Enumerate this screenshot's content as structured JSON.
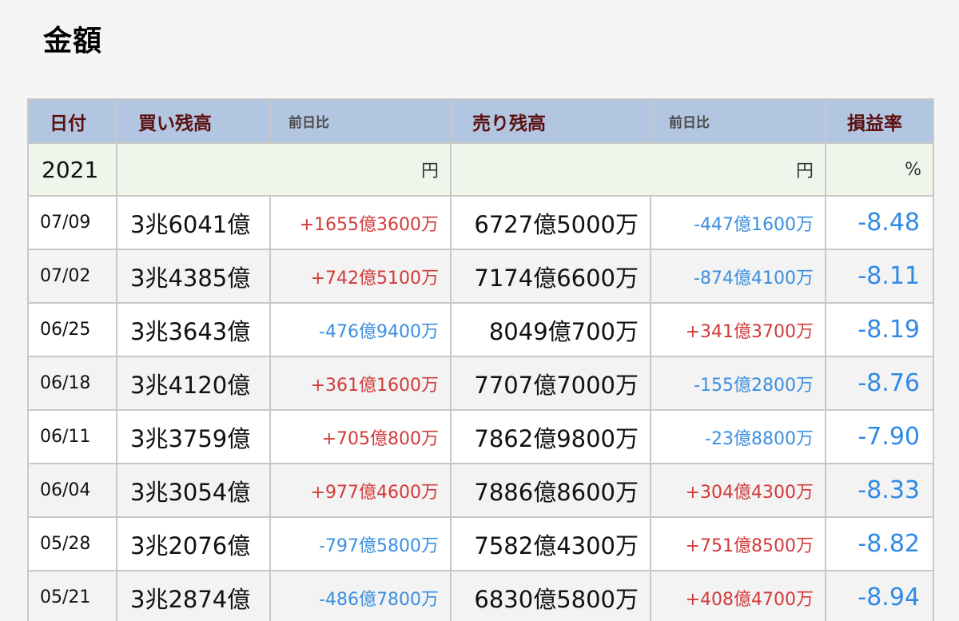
{
  "title": "金額",
  "table": {
    "headers": {
      "date": "日付",
      "buy_balance": "買い残高",
      "buy_change": "前日比",
      "sell_balance": "売り残高",
      "sell_change": "前日比",
      "pl_rate": "損益率"
    },
    "year": "2021",
    "units": {
      "buy": "円",
      "sell": "円",
      "rate": "%"
    },
    "rows": [
      {
        "date": "07/09",
        "buy": "3兆6041億",
        "buy_change": "+1655億3600万",
        "sell": "6727億5000万",
        "sell_change": "-447億1600万",
        "rate": "-8.48"
      },
      {
        "date": "07/02",
        "buy": "3兆4385億",
        "buy_change": "+742億5100万",
        "sell": "7174億6600万",
        "sell_change": "-874億4100万",
        "rate": "-8.11"
      },
      {
        "date": "06/25",
        "buy": "3兆3643億",
        "buy_change": "-476億9400万",
        "sell": "8049億700万",
        "sell_change": "+341億3700万",
        "rate": "-8.19"
      },
      {
        "date": "06/18",
        "buy": "3兆4120億",
        "buy_change": "+361億1600万",
        "sell": "7707億7000万",
        "sell_change": "-155億2800万",
        "rate": "-8.76"
      },
      {
        "date": "06/11",
        "buy": "3兆3759億",
        "buy_change": "+705億800万",
        "sell": "7862億9800万",
        "sell_change": "-23億8800万",
        "rate": "-7.90"
      },
      {
        "date": "06/04",
        "buy": "3兆3054億",
        "buy_change": "+977億4600万",
        "sell": "7886億8600万",
        "sell_change": "+304億4300万",
        "rate": "-8.33"
      },
      {
        "date": "05/28",
        "buy": "3兆2076億",
        "buy_change": "-797億5800万",
        "sell": "7582億4300万",
        "sell_change": "+751億8500万",
        "rate": "-8.82"
      },
      {
        "date": "05/21",
        "buy": "3兆2874億",
        "buy_change": "-486億7800万",
        "sell": "6830億5800万",
        "sell_change": "+408億4700万",
        "rate": "-8.94"
      }
    ]
  },
  "colors": {
    "header_bg": "#b3c6e1",
    "header_text": "#5a1010",
    "unit_row_bg": "#eef5ea",
    "increase": "#d23a3a",
    "decrease": "#3b8fe0",
    "rate": "#2f8ae6"
  }
}
